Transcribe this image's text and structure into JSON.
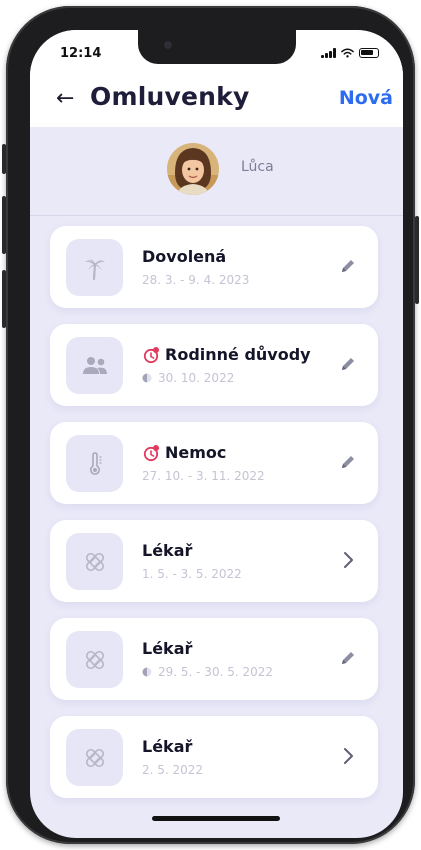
{
  "status": {
    "time": "12:14"
  },
  "header": {
    "back_glyph": "←",
    "title": "Omluvenky",
    "new_label": "Nová"
  },
  "student": {
    "name": "Lůca"
  },
  "colors": {
    "accent": "#2d6cf0",
    "alert": "#e23a5f",
    "card_icon_bg": "#e6e6f6",
    "screen_bg": "#e9e9f8"
  },
  "excuses": [
    {
      "title": "Dovolená",
      "dates": "28. 3. - 9. 4. 2023",
      "icon": "palm-tree-icon",
      "alert": false,
      "half_day": false,
      "action": "edit"
    },
    {
      "title": "Rodinné důvody",
      "dates": "30. 10. 2022",
      "icon": "people-icon",
      "alert": true,
      "half_day": true,
      "action": "edit"
    },
    {
      "title": "Nemoc",
      "dates": "27. 10. - 3. 11. 2022",
      "icon": "thermometer-icon",
      "alert": true,
      "half_day": false,
      "action": "edit"
    },
    {
      "title": "Lékař",
      "dates": "1. 5. - 3. 5. 2022",
      "icon": "bandage-icon",
      "alert": false,
      "half_day": false,
      "action": "open"
    },
    {
      "title": "Lékař",
      "dates": "29. 5. - 30. 5. 2022",
      "icon": "bandage-icon",
      "alert": false,
      "half_day": true,
      "action": "edit"
    },
    {
      "title": "Lékař",
      "dates": "2. 5. 2022",
      "icon": "bandage-icon",
      "alert": false,
      "half_day": false,
      "action": "open"
    }
  ]
}
